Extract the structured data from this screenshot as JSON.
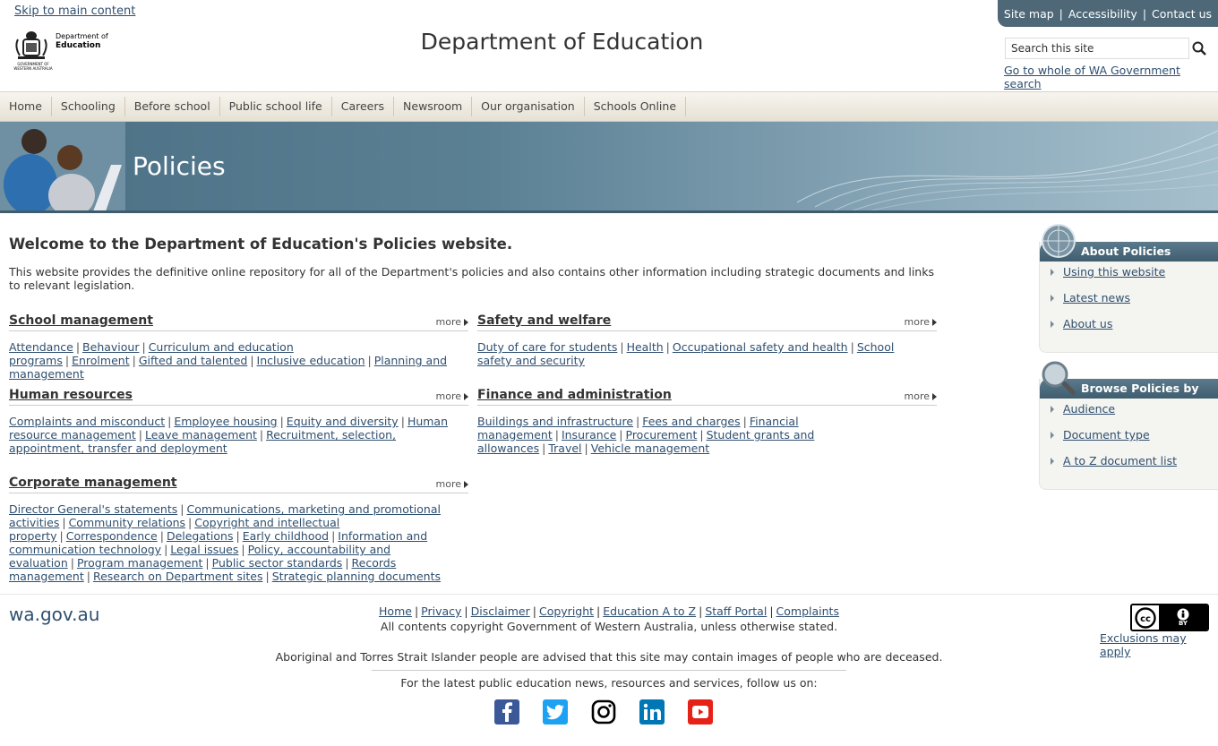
{
  "header": {
    "skip_link": "Skip to main content",
    "logo": {
      "line1": "Department of",
      "line2": "Education",
      "crest_caption": "GOVERNMENT OF WESTERN AUSTRALIA"
    },
    "site_title": "Department of Education",
    "top_links": [
      "Site map",
      "Accessibility",
      "Contact us"
    ],
    "search": {
      "placeholder": "Search this site",
      "value": "Search this site"
    },
    "wa_search_link": "Go to whole of WA Government search"
  },
  "nav": {
    "items": [
      "Home",
      "Schooling",
      "Before school",
      "Public school life",
      "Careers",
      "Newsroom",
      "Our organisation",
      "Schools Online"
    ]
  },
  "banner": {
    "title": "Policies"
  },
  "main": {
    "welcome": "Welcome to the Department of Education's Policies website.",
    "intro": "This website provides the definitive online repository for all of the Department's policies and also contains other information including strategic documents and links to relevant legislation.",
    "more_label": "more",
    "sections": {
      "school": {
        "title": "School management",
        "links": [
          "Attendance",
          "Behaviour",
          "Curriculum and education programs",
          "Enrolment",
          "Gifted and talented",
          "Inclusive education",
          "Planning and management"
        ]
      },
      "safety": {
        "title": "Safety and welfare",
        "links": [
          "Duty of care for students",
          "Health",
          "Occupational safety and health",
          "School safety and security"
        ]
      },
      "hr": {
        "title": "Human resources",
        "links": [
          "Complaints and misconduct",
          "Employee housing",
          "Equity and diversity",
          "Human resource management",
          "Leave management",
          "Recruitment, selection, appointment, transfer and deployment"
        ]
      },
      "finance": {
        "title": "Finance and administration",
        "links": [
          "Buildings and infrastructure",
          "Fees and charges",
          "Financial management",
          "Insurance",
          "Procurement",
          "Student grants and allowances",
          "Travel",
          "Vehicle management"
        ]
      },
      "corporate": {
        "title": "Corporate management",
        "links": [
          "Director General's statements",
          "Communications, marketing and promotional activities",
          "Community relations",
          "Copyright and intellectual property",
          "Correspondence",
          "Delegations",
          "Early childhood",
          "Information and communication technology",
          "Legal issues",
          "Policy, accountability and evaluation",
          "Program management",
          "Public sector standards",
          "Records management",
          "Research on Department sites",
          "Strategic planning documents"
        ]
      }
    }
  },
  "sidebar": {
    "about": {
      "title": "About Policies",
      "items": [
        "Using this website",
        "Latest news",
        "About us"
      ]
    },
    "browse": {
      "title": "Browse Policies by",
      "items": [
        "Audience",
        "Document type",
        "A to Z document list"
      ]
    }
  },
  "footer": {
    "wagov": "wa.gov.au",
    "links": [
      "Home",
      "Privacy",
      "Disclaimer",
      "Copyright",
      "Education A to Z",
      "Staff Portal",
      "Complaints"
    ],
    "copyright": "All contents copyright Government of Western Australia, unless otherwise stated.",
    "aboriginal_notice": "Aboriginal and Torres Strait Islander people are advised that this site may contain images of people who are deceased.",
    "follow_text": "For the latest public education news, resources and services, follow us on:",
    "social": [
      "facebook-icon",
      "twitter-icon",
      "instagram-icon",
      "linkedin-icon",
      "youtube-icon"
    ],
    "cc_badge": {
      "cc": "cc",
      "by": "BY"
    },
    "exclusions_link": "Exclusions may apply"
  },
  "colors": {
    "link": "#2f4f6f",
    "toplinks_bg": "#4e6878",
    "banner": "#5b8094",
    "sidebar_head": "#4a6879",
    "facebook": "#3b5998",
    "twitter": "#1da1f2",
    "linkedin": "#0077b5",
    "youtube": "#e62117"
  }
}
